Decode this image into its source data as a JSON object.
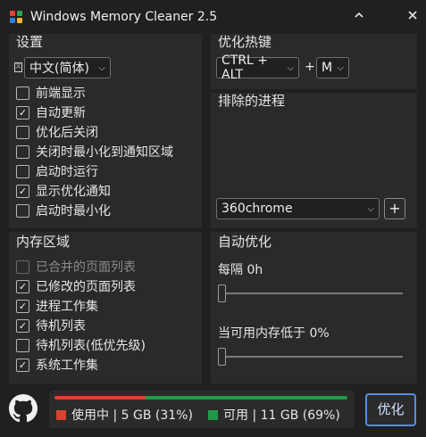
{
  "window": {
    "title": "Windows Memory Cleaner 2.5",
    "minimize_glyph": "^",
    "close_glyph": "✕"
  },
  "settings": {
    "header": "设置",
    "language": "中文(简体)",
    "items": [
      {
        "label": "前端显示",
        "checked": false
      },
      {
        "label": "自动更新",
        "checked": true
      },
      {
        "label": "优化后关闭",
        "checked": false
      },
      {
        "label": "关闭时最小化到通知区域",
        "checked": false
      },
      {
        "label": "启动时运行",
        "checked": false
      },
      {
        "label": "显示优化通知",
        "checked": true
      },
      {
        "label": "启动时最小化",
        "checked": false
      }
    ]
  },
  "hotkey": {
    "header": "优化热键",
    "modifier": "CTRL + ALT",
    "plus": "+",
    "key": "M"
  },
  "excluded": {
    "header": "排除的进程",
    "selected": "360chrome",
    "add_label": "+"
  },
  "memory_areas": {
    "header": "内存区域",
    "items": [
      {
        "label": "已合并的页面列表",
        "checked": false,
        "disabled": true
      },
      {
        "label": "已修改的页面列表",
        "checked": true,
        "disabled": false
      },
      {
        "label": "进程工作集",
        "checked": true,
        "disabled": false
      },
      {
        "label": "待机列表",
        "checked": true,
        "disabled": false
      },
      {
        "label": "待机列表(低优先级)",
        "checked": false,
        "disabled": false
      },
      {
        "label": "系统工作集",
        "checked": true,
        "disabled": false
      }
    ]
  },
  "auto_optimize": {
    "header": "自动优化",
    "interval_label": "每隔 0h",
    "interval_value": 0,
    "low_memory_label": "当可用内存低于 0%",
    "low_memory_value": 0
  },
  "status": {
    "used_text": "使用中 | 5 GB (31%)",
    "free_text": "可用 | 11 GB (69%)",
    "used_fraction": 0.31,
    "used_color": "#d6432e",
    "free_color": "#1f9a48"
  },
  "optimize_button": "优化",
  "icons": {
    "app": "app-logo-icon",
    "github": "github-icon"
  }
}
